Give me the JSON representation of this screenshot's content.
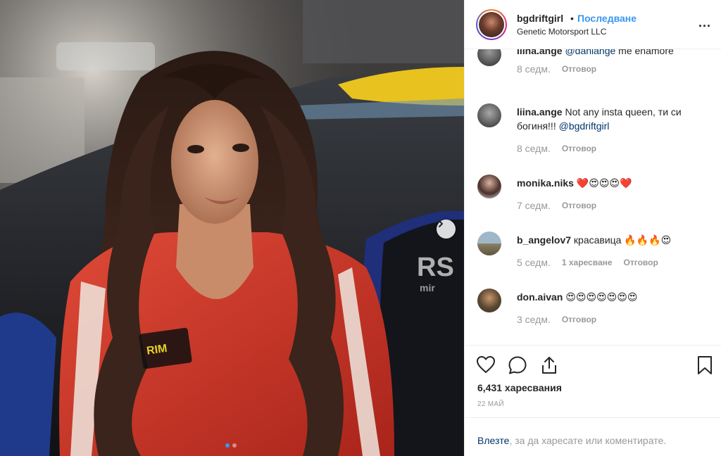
{
  "post": {
    "photo_alt": "",
    "carousel": {
      "slides": 2,
      "active_index": 0
    }
  },
  "header": {
    "username": "bgdriftgirl",
    "separator": "•",
    "follow_label": "Последване",
    "location": "Genetic Motorsport LLC",
    "more_label": "..."
  },
  "comments": [
    {
      "user": "liina.ange",
      "mention": "@danlange",
      "text": " me enamore",
      "time": "8 седм.",
      "likes": "",
      "reply": "Отговор"
    },
    {
      "user": "liina.ange",
      "text": "Not any insta queen, ти си богиня!!! ",
      "mention": "@bgdriftgirl",
      "time": "8 седм.",
      "likes": "",
      "reply": "Отговор"
    },
    {
      "user": "monika.niks",
      "text": "❤️😍😍😍❤️",
      "time": "7 седм.",
      "likes": "",
      "reply": "Отговор"
    },
    {
      "user": "b_angelov7",
      "text": "красавица 🔥🔥🔥😍",
      "time": "5 седм.",
      "likes": "1 харесване",
      "reply": "Отговор"
    },
    {
      "user": "don.aivan",
      "text": "😍😍😍😍😍😍😍",
      "time": "3 седм.",
      "likes": "",
      "reply": "Отговор"
    }
  ],
  "actions": {
    "like_icon": "heart-icon",
    "comment_icon": "comment-icon",
    "share_icon": "share-icon",
    "save_icon": "bookmark-icon",
    "likes_count": "6,431 харесвания",
    "date": "22 МАЙ"
  },
  "footer": {
    "login_link": "Влезте",
    "login_text": ", за да харесате или коментирате."
  },
  "colors": {
    "accent": "#3897f0",
    "text": "#262626",
    "muted": "#999999",
    "link": "#003569",
    "jacket": "#d8382c"
  }
}
